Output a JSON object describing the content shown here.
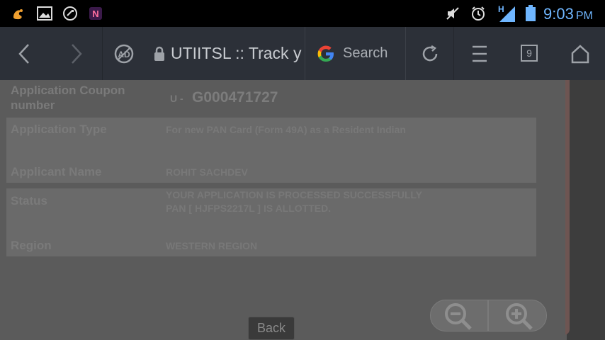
{
  "status_bar": {
    "time": "9:03",
    "ampm": "PM",
    "network": "H",
    "left_icons": [
      "uc-browser-icon",
      "gallery-icon",
      "call-icon",
      "onenote-icon"
    ],
    "right_icons": [
      "mute-icon",
      "alarm-icon",
      "signal-icon",
      "battery-icon"
    ]
  },
  "toolbar": {
    "url_text": "UTIITSL :: Track y",
    "search_label": "Search",
    "tab_count": "9"
  },
  "page": {
    "coupon_label": "Application Coupon number",
    "coupon_prefix": "U -",
    "coupon_value": "G000471727",
    "type_label": "Application Type",
    "type_value": "For new PAN Card (Form 49A) as a Resident Indian",
    "name_label": "Applicant Name",
    "name_value": "ROHIT SACHDEV",
    "status_label": "Status",
    "status_line1": "YOUR APPLICATION IS PROCESSED SUCCESSFULLY",
    "status_line2": "PAN [ HJFPS2217L ] IS ALLOTTED.",
    "region_label": "Region",
    "region_value": "WESTERN REGION",
    "back_label": "Back"
  },
  "colors": {
    "status_bar_bg": "#000000",
    "toolbar_bg": "#2c3038",
    "time_color": "#6fb6ff",
    "page_bg": "#5b5b5b"
  }
}
